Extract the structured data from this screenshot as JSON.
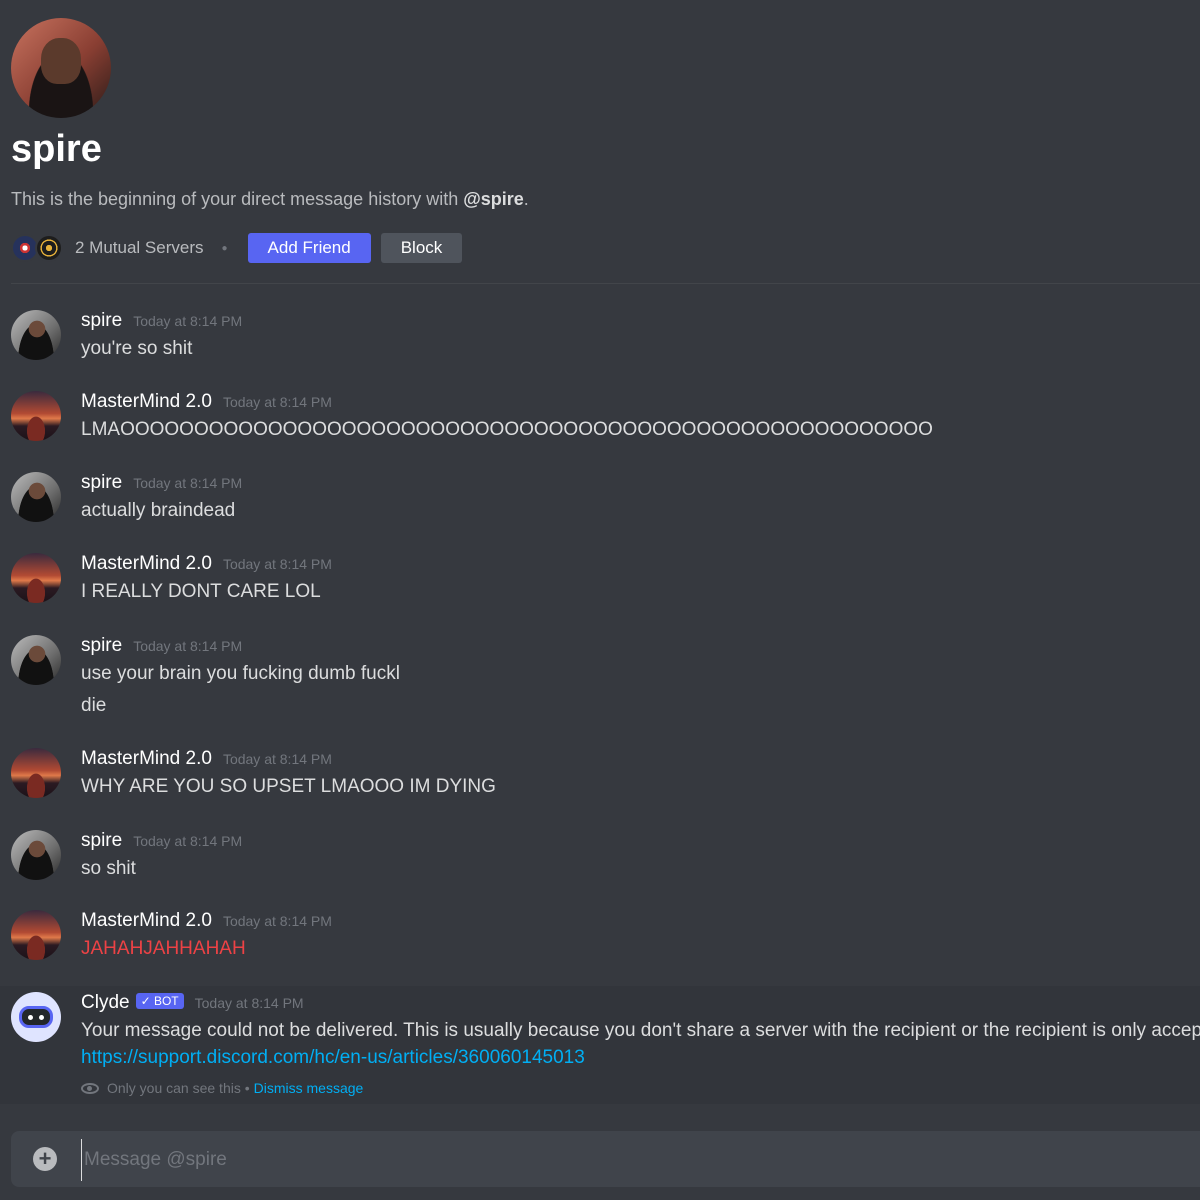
{
  "header": {
    "title": "spire",
    "intro_prefix": "This is the beginning of your direct message history with ",
    "intro_handle": "@spire",
    "intro_suffix": ".",
    "mutual_servers": "2 Mutual Servers",
    "add_friend_label": "Add Friend",
    "block_label": "Block"
  },
  "messages": [
    {
      "author": "spire",
      "time": "Today at 8:14 PM",
      "lines": [
        "you're so shit"
      ]
    },
    {
      "author": "MasterMind 2.0",
      "time": "Today at 8:14 PM",
      "lines": [
        "LMAOOOOOOOOOOOOOOOOOOOOOOOOOOOOOOOOOOOOOOOOOOOOOOOOOOOOOOO"
      ]
    },
    {
      "author": "spire",
      "time": "Today at 8:14 PM",
      "lines": [
        "actually braindead"
      ]
    },
    {
      "author": "MasterMind 2.0",
      "time": "Today at 8:14 PM",
      "lines": [
        "I REALLY DONT CARE LOL"
      ]
    },
    {
      "author": "spire",
      "time": "Today at 8:14 PM",
      "lines": [
        "use your brain you fucking dumb fuckl",
        "die"
      ]
    },
    {
      "author": "MasterMind 2.0",
      "time": "Today at 8:14 PM",
      "lines": [
        "WHY ARE YOU SO UPSET LMAOOO IM DYING"
      ]
    },
    {
      "author": "spire",
      "time": "Today at 8:14 PM",
      "lines": [
        "so shit"
      ]
    },
    {
      "author": "MasterMind 2.0",
      "time": "Today at 8:14 PM",
      "lines": [
        "JAHAHJAHHAHAH"
      ]
    }
  ],
  "clyde": {
    "author": "Clyde",
    "badge": "✓ BOT",
    "time": "Today at 8:14 PM",
    "text": "Your message could not be delivered. This is usually because you don't share a server with the recipient or the recipient is only accepting direct messages from friends. You can see the full list of reasons here:",
    "link": "https://support.discord.com/hc/en-us/articles/360060145013",
    "only_you": "Only you can see this •",
    "dismiss": "Dismiss message"
  },
  "composer": {
    "placeholder": "Message @spire"
  },
  "colors": {
    "background": "#36393f",
    "accent": "#5865f2",
    "link": "#00aff4",
    "highlight_text": "#ed4245"
  }
}
